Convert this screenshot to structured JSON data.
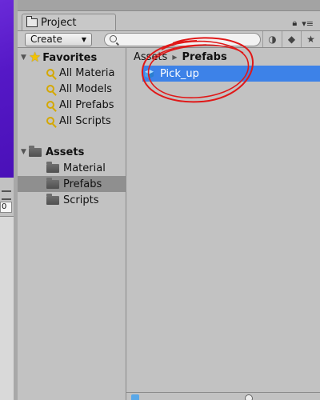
{
  "window": {
    "tab_label": "Project"
  },
  "toolbar": {
    "create_label": "Create",
    "search_value": "",
    "filter_icons": [
      "filter-by-type-icon",
      "filter-by-label-icon",
      "favorites-star-icon"
    ]
  },
  "tree": {
    "favorites": {
      "label": "Favorites",
      "items": [
        {
          "label": "All Materia"
        },
        {
          "label": "All Models"
        },
        {
          "label": "All Prefabs"
        },
        {
          "label": "All Scripts"
        }
      ]
    },
    "assets": {
      "label": "Assets",
      "items": [
        {
          "label": "Material",
          "selected": false
        },
        {
          "label": "Prefabs",
          "selected": true
        },
        {
          "label": "Scripts",
          "selected": false
        }
      ]
    }
  },
  "content": {
    "breadcrumb": [
      "Assets",
      "Prefabs"
    ],
    "assets": [
      {
        "label": "Pick_up",
        "selected": true
      }
    ]
  },
  "left_strip": {
    "field_value": "0"
  },
  "colors": {
    "selection_blue": "#3d82e8",
    "annotation_red": "#e01818",
    "panel_gray": "#c2c2c2",
    "favorite_gold": "#f2c200"
  }
}
